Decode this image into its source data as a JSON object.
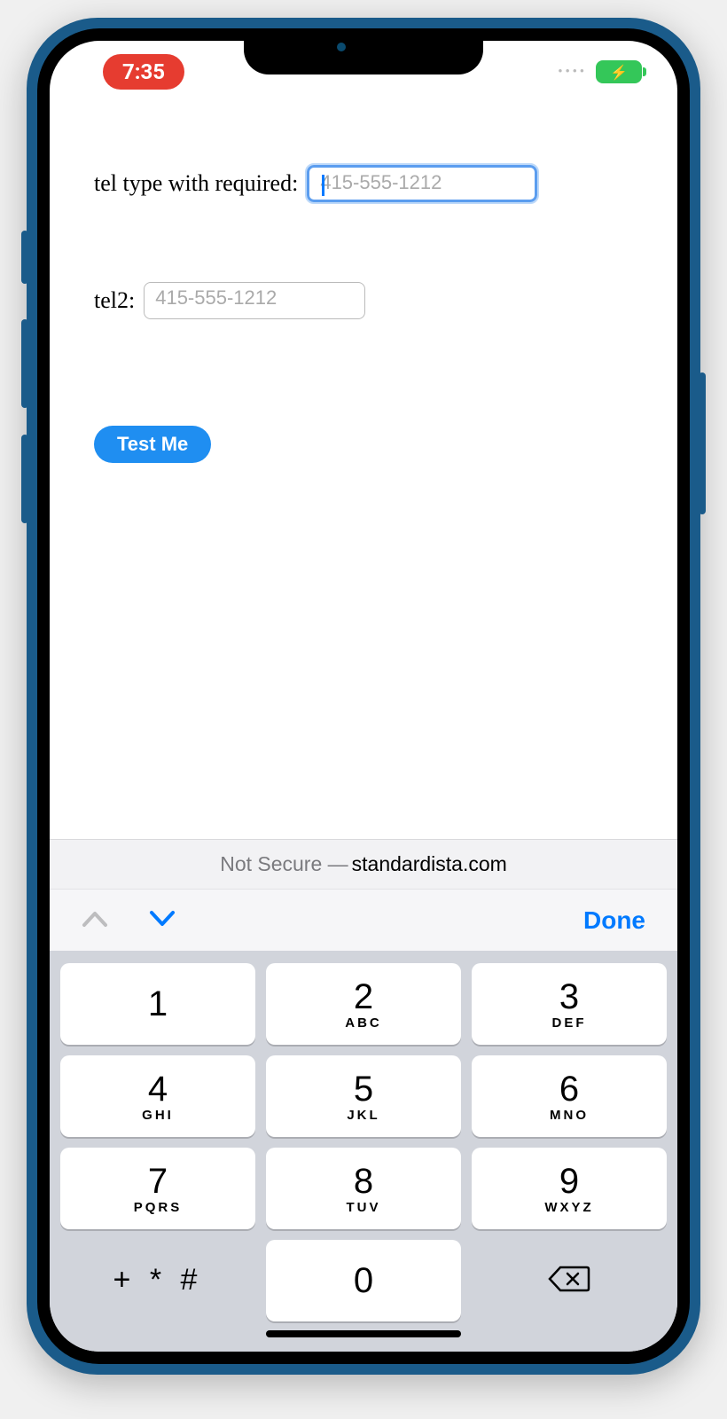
{
  "statusBar": {
    "time": "7:35"
  },
  "form": {
    "label1": "tel type with required:",
    "placeholder1": "415-555-1212",
    "label2": "tel2:",
    "placeholder2": "415-555-1212",
    "buttonLabel": "Test Me"
  },
  "urlBar": {
    "prefix": "Not Secure —",
    "domain": "standardista.com"
  },
  "accessory": {
    "doneLabel": "Done"
  },
  "keypad": {
    "k1": {
      "num": "1",
      "sub": ""
    },
    "k2": {
      "num": "2",
      "sub": "ABC"
    },
    "k3": {
      "num": "3",
      "sub": "DEF"
    },
    "k4": {
      "num": "4",
      "sub": "GHI"
    },
    "k5": {
      "num": "5",
      "sub": "JKL"
    },
    "k6": {
      "num": "6",
      "sub": "MNO"
    },
    "k7": {
      "num": "7",
      "sub": "PQRS"
    },
    "k8": {
      "num": "8",
      "sub": "TUV"
    },
    "k9": {
      "num": "9",
      "sub": "WXYZ"
    },
    "sym": "+ * #",
    "k0": "0"
  }
}
